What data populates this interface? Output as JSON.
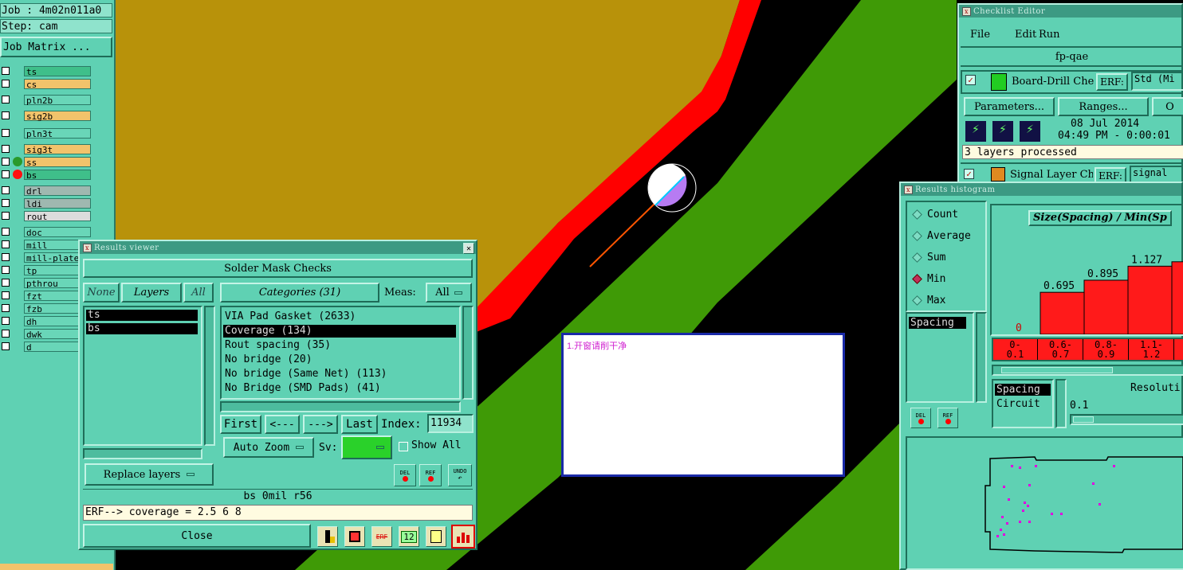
{
  "canvas": {
    "note_text": "1.开窗请削干净",
    "colors": {
      "olive": "#b8920a",
      "green": "#3f9a06",
      "red": "#ff0000",
      "black": "#000000",
      "pad_white": "#ffffff",
      "pad_violet": "#b77bf2"
    }
  },
  "job_panel": {
    "job": "Job  :  4m02n011a0",
    "step": "Step:  cam",
    "job_matrix_label": "Job Matrix ..."
  },
  "layers": [
    {
      "name": "ts",
      "color": "#3fbf8a",
      "mark": ""
    },
    {
      "name": "cs",
      "color": "#f2c36b",
      "mark": ""
    },
    {
      "name": "pln2b",
      "color": "#69d6b8",
      "mark": ""
    },
    {
      "name": "sig2b",
      "color": "#f2c36b",
      "mark": ""
    },
    {
      "name": "pln3t",
      "color": "#69d6b8",
      "mark": ""
    },
    {
      "name": "sig3t",
      "color": "#f2c36b",
      "mark": ""
    },
    {
      "name": "ss",
      "color": "#f2c36b",
      "mark": "green"
    },
    {
      "name": "bs",
      "color": "#3fbf8a",
      "mark": "red"
    },
    {
      "name": "drl",
      "color": "#9fb8b0",
      "mark": ""
    },
    {
      "name": "ldi",
      "color": "#9fb8b0",
      "mark": ""
    },
    {
      "name": "rout",
      "color": "#dcdcdc",
      "mark": ""
    },
    {
      "name": "doc",
      "color": "#69d6b8",
      "mark": ""
    },
    {
      "name": "mill",
      "color": "#69d6b8",
      "mark": ""
    },
    {
      "name": "mill-plate",
      "color": "#69d6b8",
      "mark": ""
    },
    {
      "name": "tp",
      "color": "#69d6b8",
      "mark": ""
    },
    {
      "name": "pthrou",
      "color": "#69d6b8",
      "mark": ""
    },
    {
      "name": "fzt",
      "color": "#69d6b8",
      "mark": ""
    },
    {
      "name": "fzb",
      "color": "#69d6b8",
      "mark": ""
    },
    {
      "name": "dh",
      "color": "#69d6b8",
      "mark": ""
    },
    {
      "name": "dwk",
      "color": "#69d6b8",
      "mark": ""
    },
    {
      "name": "d",
      "color": "#69d6b8",
      "mark": ""
    }
  ],
  "results_viewer": {
    "title": "Results viewer",
    "header": "Solder Mask Checks",
    "none_label": "None",
    "layers_label": "Layers",
    "all_label": "All",
    "categories_label": "Categories (31)",
    "meas_label": "Meas:",
    "meas_value": "All",
    "layer_list": [
      "ts",
      "bs"
    ],
    "category_list": [
      "VIA Pad Gasket (2633)",
      "Coverage (134)",
      "Rout spacing (35)",
      "No bridge (20)",
      "No bridge (Same Net) (113)",
      "No Bridge (SMD Pads) (41)"
    ],
    "selected_category": 1,
    "first_label": "First",
    "prev_label": "<---",
    "next_label": "--->",
    "last_label": "Last",
    "index_label": "Index:",
    "index_value": "11934",
    "auto_zoom_label": "Auto Zoom",
    "sv_label": "Sv:",
    "show_all_label": "Show All",
    "replace_layers_label": "Replace layers",
    "del_label": "DEL",
    "ref_label": "REF",
    "undo_label": "UNDO",
    "status_line": "bs  0mil   r56",
    "erf_line": "ERF--> coverage = 2.5 6 8",
    "close_label": "Close",
    "toolbar_icons": [
      "ruler-icon",
      "exit-icon",
      "erf-icon",
      "counter-icon",
      "report-icon",
      "histogram-icon"
    ]
  },
  "checklist_editor": {
    "title": "Checklist Editor",
    "menu": [
      "File",
      "Edit",
      "Run"
    ],
    "checklist_name": "fp-qae",
    "item1_name": "Board-Drill Che",
    "erf_label": "ERF:",
    "item1_erf": "Std (Mi",
    "parameters_label": "Parameters...",
    "ranges_label": "Ranges...",
    "other_label": "O",
    "date": "08 Jul 2014",
    "time": "04:49 PM - 0:00:01",
    "status": "3 layers processed",
    "item2_name": "Signal Layer Ch",
    "item2_erf": "signal"
  },
  "histogram": {
    "title": "Results histogram",
    "modes": [
      "Count",
      "Average",
      "Sum",
      "Min",
      "Max"
    ],
    "selected_mode": "Min",
    "list": [
      "Spacing"
    ],
    "chart_title": "Size(Spacing) / Min(Sp",
    "del_label": "DEL",
    "ref_label": "REF",
    "lower_list": [
      "Spacing",
      "Circuit"
    ],
    "resolution_label": "Resoluti",
    "resolution_value": "0.1",
    "chart_data": {
      "type": "bar",
      "categories": [
        "0-\n0.1",
        "0.6-\n0.7",
        "0.8-\n0.9",
        "1.1-\n1.2",
        "1"
      ],
      "values": [
        0,
        0.695,
        0.895,
        1.127,
        1.2
      ],
      "value_labels": [
        "0",
        "0.695",
        "0.895",
        "1.127",
        ""
      ],
      "range_labels": [
        [
          "0-",
          "0.1"
        ],
        [
          "0.6-",
          "0.7"
        ],
        [
          "0.8-",
          "0.9"
        ],
        [
          "1.1-",
          "1.2"
        ],
        [
          "1",
          ""
        ]
      ],
      "bar_color": "#ff1a1a"
    }
  }
}
